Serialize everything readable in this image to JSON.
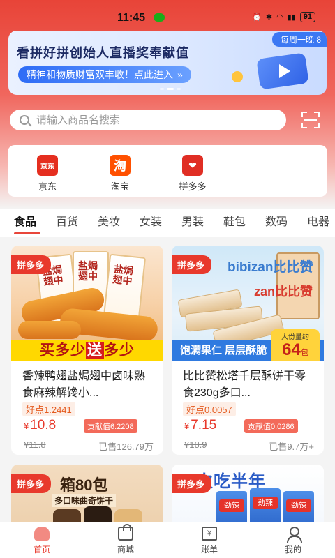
{
  "status_bar": {
    "time": "11:45",
    "battery": "91"
  },
  "banner": {
    "title": "看拼好拼创始人直播奖奉献值",
    "button": "精神和物质财富双丰收！点此进入",
    "corner": "每周一晚 8"
  },
  "search": {
    "placeholder": "请输入商品名搜索"
  },
  "platforms": [
    {
      "label": "京东",
      "logo": "京东"
    },
    {
      "label": "淘宝",
      "logo": "淘"
    },
    {
      "label": "拼多多",
      "logo": ""
    }
  ],
  "categories": [
    "食品",
    "百货",
    "美妆",
    "女装",
    "男装",
    "鞋包",
    "数码",
    "电器"
  ],
  "active_category": "食品",
  "products": [
    {
      "tag": "拼多多",
      "image_text": {
        "pack": "盐焗翅中",
        "promo_a": "买多少",
        "promo_w": "送",
        "promo_b": "多少"
      },
      "name": "香辣鸭翅盐焗翅中卤味熟食麻辣解馋小...",
      "haodian": "好点1.2441",
      "currency": "¥",
      "price": "10.8",
      "contribution": "贡献值6.2208",
      "original_price": "¥11.8",
      "sold": "已售126.79万"
    },
    {
      "tag": "拼多多",
      "image_text": {
        "brand": "bibizan比比赞",
        "brand2": "zan比比赞",
        "strip": "饱满果仁 层层酥脆",
        "badge_top": "大份量约",
        "badge_num": "64",
        "badge_unit": "包"
      },
      "name": "比比赞松塔千层酥饼干零食230g多口...",
      "haodian": "好点0.0057",
      "currency": "¥",
      "price": "7.15",
      "contribution": "贡献值0.0286",
      "original_price": "¥18.9",
      "sold": "已售9.7万+"
    },
    {
      "tag": "拼多多",
      "image_text": {
        "title": "箱80包",
        "sub": "多口味曲奇饼干"
      }
    },
    {
      "tag": "拼多多",
      "image_text": {
        "title": "一次吃半年",
        "pack": "劲辣"
      }
    }
  ],
  "tabbar": [
    {
      "label": "首页",
      "icon": "home-icon"
    },
    {
      "label": "商城",
      "icon": "bag-icon"
    },
    {
      "label": "账单",
      "icon": "bill-icon",
      "glyph": "¥"
    },
    {
      "label": "我的",
      "icon": "person-icon"
    }
  ],
  "colors": {
    "accent": "#e8392c",
    "header": "#e84438",
    "banner_blue": "#2e6cf6"
  }
}
